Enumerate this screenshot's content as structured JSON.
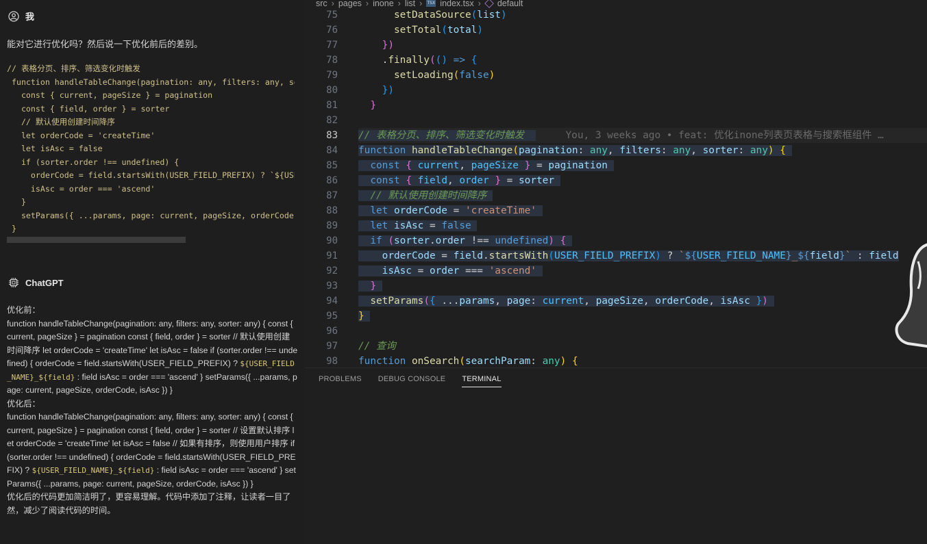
{
  "chat": {
    "user": {
      "name": "我",
      "question": "能对它进行优化吗？然后说一下优化前后的差别。",
      "code_lines": [
        "// 表格分页、排序、筛选变化时触发",
        " function handleTableChange(pagination: any, filters: any, sorter: any) {",
        "   const { current, pageSize } = pagination",
        "   const { field, order } = sorter",
        "   // 默认使用创建时间降序",
        "   let orderCode = 'createTime'",
        "   let isAsc = false",
        "   if (sorter.order !== undefined) {",
        "     orderCode = field.startsWith(USER_FIELD_PREFIX) ? `${USER_FIELD_NAME}_${field}` : field",
        "     isAsc = order === 'ascend'",
        "   }",
        "   setParams({ ...params, page: current, pageSize, orderCode, isAsc })",
        " }"
      ]
    },
    "bot": {
      "name": "ChatGPT",
      "before_label": "优化前：",
      "before_text_1": "function handleTableChange(pagination: any, filters: any, sorter: any) { const { current, pageSize } = pagination const { field, order } = sorter // 默认使用创建时间降序 let orderCode = 'createTime' let isAsc = false if (sorter.order !== undefined) { orderCode = field.startsWith(USER_FIELD_PREFIX) ? ",
      "before_code": "${USER_FIELD_NAME}_${field}",
      "before_text_2": " : field isAsc = order === 'ascend' } setParams({ ...params, page: current, pageSize, orderCode, isAsc }) }",
      "after_label": "优化后：",
      "after_text_1": "function handleTableChange(pagination: any, filters: any, sorter: any) { const { current, pageSize } = pagination const { field, order } = sorter // 设置默认排序 let orderCode = 'createTime' let isAsc = false // 如果有排序，则使用用户排序 if (sorter.order !== undefined) { orderCode = field.startsWith(USER_FIELD_PREFIX) ? ",
      "after_code": "${USER_FIELD_NAME}_${field}",
      "after_text_2": " : field isAsc = order === 'ascend' } setParams({ ...params, page: current, pageSize, orderCode, isAsc }) }",
      "summary": "优化后的代码更加简洁明了，更容易理解。代码中添加了注释，让读者一目了然，减少了阅读代码的时间。"
    }
  },
  "editor": {
    "breadcrumb": [
      "src",
      "pages",
      "inone",
      "list",
      "index.tsx",
      "default"
    ],
    "tsx_badge": "TSX",
    "active_line": 83,
    "line_numbers": [
      "75",
      "76",
      "77",
      "78",
      "79",
      "80",
      "81",
      "82",
      "83",
      "84",
      "85",
      "86",
      "87",
      "88",
      "89",
      "90",
      "91",
      "92",
      "93",
      "94",
      "95",
      "96",
      "97",
      "98"
    ],
    "blame": "You, 3 weeks ago • feat: 优化inone列表页表格与搜索框组件 …"
  },
  "panel": {
    "tabs": [
      "PROBLEMS",
      "DEBUG CONSOLE",
      "TERMINAL"
    ],
    "active_tab": "TERMINAL"
  },
  "colors": {
    "background": "#1f1f1f",
    "keyword": "#569cd6",
    "function": "#dcdcaa",
    "string": "#ce9178",
    "variable": "#9cdcfe",
    "comment": "#6a9955",
    "bracket_gold": "#ffd700",
    "bracket_purple": "#da70d6"
  }
}
